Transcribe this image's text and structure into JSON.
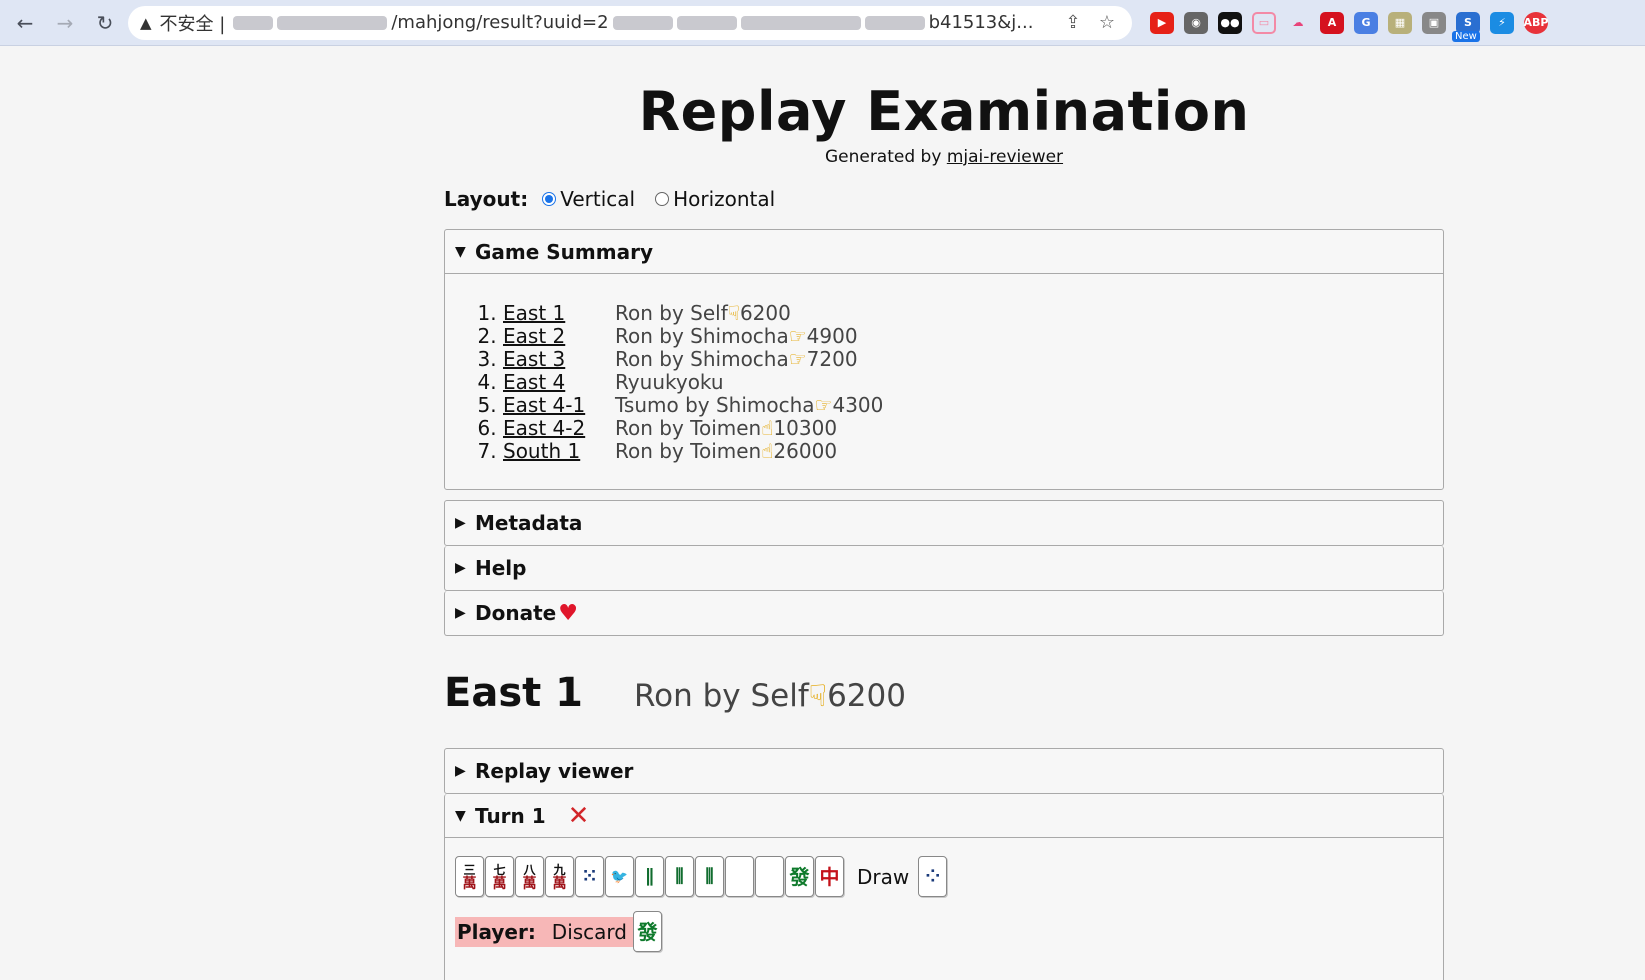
{
  "browser": {
    "insecure_label": "不安全 |",
    "url_visible_path": "/mahjong/result?uuid=2",
    "url_visible_tail": "b41513&j...",
    "extensions": [
      "youtube-ext",
      "film-ext",
      "dots-ext",
      "bilibili-ext",
      "cloud-ext",
      "pdf-ext",
      "translate-ext",
      "image-ext",
      "screen-ext",
      "new-ext",
      "bolt-ext",
      "abp-ext"
    ],
    "new_badge": "New",
    "abp_label": "ABP"
  },
  "page": {
    "title": "Replay Examination",
    "generated_prefix": "Generated by",
    "generated_link": "mjai-reviewer",
    "layout_label": "Layout:",
    "layout_options": [
      "Vertical",
      "Horizontal"
    ],
    "layout_selected": "Vertical"
  },
  "game_summary": {
    "title": "Game Summary",
    "rounds": [
      {
        "name": "East 1",
        "result": "Ron by Self",
        "points": "6200",
        "hand": "☟"
      },
      {
        "name": "East 2",
        "result": "Ron by Shimocha",
        "points": "4900",
        "hand": "☞"
      },
      {
        "name": "East 3",
        "result": "Ron by Shimocha",
        "points": "7200",
        "hand": "☞"
      },
      {
        "name": "East 4",
        "result": "Ryuukyoku",
        "points": "",
        "hand": ""
      },
      {
        "name": "East 4-1",
        "result": "Tsumo by Shimocha",
        "points": "4300",
        "hand": "☞"
      },
      {
        "name": "East 4-2",
        "result": "Ron by Toimen",
        "points": "10300",
        "hand": "☝"
      },
      {
        "name": "South 1",
        "result": "Ron by Toimen",
        "points": "26000",
        "hand": "☝"
      }
    ]
  },
  "panels": {
    "metadata": "Metadata",
    "help": "Help",
    "donate": "Donate"
  },
  "round_view": {
    "title": "East 1",
    "result": "Ron by Self",
    "points": "6200",
    "hand": "☟",
    "replay_viewer": "Replay viewer",
    "turn_title": "Turn 1",
    "draw_label": "Draw",
    "player_label": "Player:",
    "discard_label": "Discard",
    "hand_tiles": [
      {
        "kind": "man",
        "top": "三",
        "bottom": "萬"
      },
      {
        "kind": "man",
        "top": "七",
        "bottom": "萬"
      },
      {
        "kind": "man",
        "top": "八",
        "bottom": "萬"
      },
      {
        "kind": "man",
        "top": "九",
        "bottom": "萬"
      },
      {
        "kind": "pin",
        "top": "",
        "bottom": "⁙"
      },
      {
        "kind": "bird",
        "top": "",
        "bottom": "🐦"
      },
      {
        "kind": "sou",
        "top": "",
        "bottom": "∥"
      },
      {
        "kind": "sou",
        "top": "",
        "bottom": "⫼"
      },
      {
        "kind": "sou",
        "top": "",
        "bottom": "⫼"
      },
      {
        "kind": "white",
        "top": "",
        "bottom": ""
      },
      {
        "kind": "white",
        "top": "",
        "bottom": ""
      },
      {
        "kind": "green",
        "top": "",
        "bottom": "發"
      },
      {
        "kind": "red",
        "top": "",
        "bottom": "中"
      }
    ],
    "draw_tile": {
      "kind": "pin",
      "top": "",
      "bottom": "⁘"
    },
    "discard_tile": {
      "kind": "green",
      "top": "",
      "bottom": "發"
    }
  }
}
